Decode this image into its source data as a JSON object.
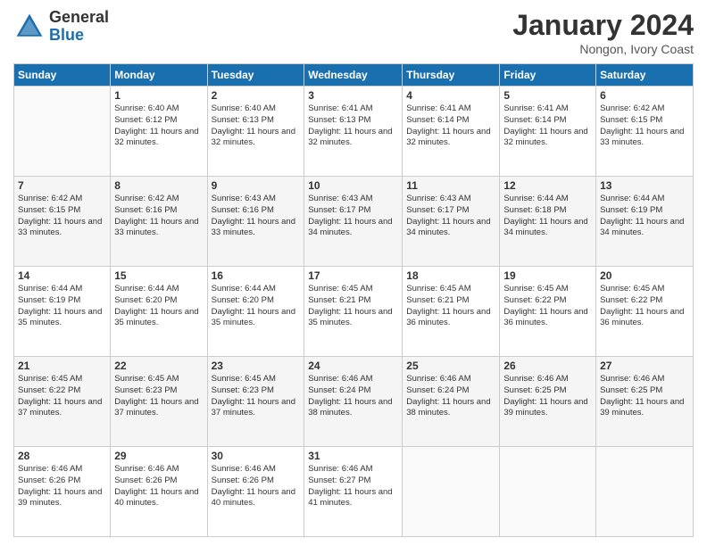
{
  "logo": {
    "general": "General",
    "blue": "Blue"
  },
  "title": "January 2024",
  "subtitle": "Nongon, Ivory Coast",
  "days_header": [
    "Sunday",
    "Monday",
    "Tuesday",
    "Wednesday",
    "Thursday",
    "Friday",
    "Saturday"
  ],
  "weeks": [
    [
      {
        "day": "",
        "empty": true
      },
      {
        "day": "1",
        "sunrise": "6:40 AM",
        "sunset": "6:12 PM",
        "daylight": "11 hours and 32 minutes."
      },
      {
        "day": "2",
        "sunrise": "6:40 AM",
        "sunset": "6:13 PM",
        "daylight": "11 hours and 32 minutes."
      },
      {
        "day": "3",
        "sunrise": "6:41 AM",
        "sunset": "6:13 PM",
        "daylight": "11 hours and 32 minutes."
      },
      {
        "day": "4",
        "sunrise": "6:41 AM",
        "sunset": "6:14 PM",
        "daylight": "11 hours and 32 minutes."
      },
      {
        "day": "5",
        "sunrise": "6:41 AM",
        "sunset": "6:14 PM",
        "daylight": "11 hours and 32 minutes."
      },
      {
        "day": "6",
        "sunrise": "6:42 AM",
        "sunset": "6:15 PM",
        "daylight": "11 hours and 33 minutes."
      }
    ],
    [
      {
        "day": "7",
        "sunrise": "6:42 AM",
        "sunset": "6:15 PM",
        "daylight": "11 hours and 33 minutes."
      },
      {
        "day": "8",
        "sunrise": "6:42 AM",
        "sunset": "6:16 PM",
        "daylight": "11 hours and 33 minutes."
      },
      {
        "day": "9",
        "sunrise": "6:43 AM",
        "sunset": "6:16 PM",
        "daylight": "11 hours and 33 minutes."
      },
      {
        "day": "10",
        "sunrise": "6:43 AM",
        "sunset": "6:17 PM",
        "daylight": "11 hours and 34 minutes."
      },
      {
        "day": "11",
        "sunrise": "6:43 AM",
        "sunset": "6:17 PM",
        "daylight": "11 hours and 34 minutes."
      },
      {
        "day": "12",
        "sunrise": "6:44 AM",
        "sunset": "6:18 PM",
        "daylight": "11 hours and 34 minutes."
      },
      {
        "day": "13",
        "sunrise": "6:44 AM",
        "sunset": "6:19 PM",
        "daylight": "11 hours and 34 minutes."
      }
    ],
    [
      {
        "day": "14",
        "sunrise": "6:44 AM",
        "sunset": "6:19 PM",
        "daylight": "11 hours and 35 minutes."
      },
      {
        "day": "15",
        "sunrise": "6:44 AM",
        "sunset": "6:20 PM",
        "daylight": "11 hours and 35 minutes."
      },
      {
        "day": "16",
        "sunrise": "6:44 AM",
        "sunset": "6:20 PM",
        "daylight": "11 hours and 35 minutes."
      },
      {
        "day": "17",
        "sunrise": "6:45 AM",
        "sunset": "6:21 PM",
        "daylight": "11 hours and 35 minutes."
      },
      {
        "day": "18",
        "sunrise": "6:45 AM",
        "sunset": "6:21 PM",
        "daylight": "11 hours and 36 minutes."
      },
      {
        "day": "19",
        "sunrise": "6:45 AM",
        "sunset": "6:22 PM",
        "daylight": "11 hours and 36 minutes."
      },
      {
        "day": "20",
        "sunrise": "6:45 AM",
        "sunset": "6:22 PM",
        "daylight": "11 hours and 36 minutes."
      }
    ],
    [
      {
        "day": "21",
        "sunrise": "6:45 AM",
        "sunset": "6:22 PM",
        "daylight": "11 hours and 37 minutes."
      },
      {
        "day": "22",
        "sunrise": "6:45 AM",
        "sunset": "6:23 PM",
        "daylight": "11 hours and 37 minutes."
      },
      {
        "day": "23",
        "sunrise": "6:45 AM",
        "sunset": "6:23 PM",
        "daylight": "11 hours and 37 minutes."
      },
      {
        "day": "24",
        "sunrise": "6:46 AM",
        "sunset": "6:24 PM",
        "daylight": "11 hours and 38 minutes."
      },
      {
        "day": "25",
        "sunrise": "6:46 AM",
        "sunset": "6:24 PM",
        "daylight": "11 hours and 38 minutes."
      },
      {
        "day": "26",
        "sunrise": "6:46 AM",
        "sunset": "6:25 PM",
        "daylight": "11 hours and 39 minutes."
      },
      {
        "day": "27",
        "sunrise": "6:46 AM",
        "sunset": "6:25 PM",
        "daylight": "11 hours and 39 minutes."
      }
    ],
    [
      {
        "day": "28",
        "sunrise": "6:46 AM",
        "sunset": "6:26 PM",
        "daylight": "11 hours and 39 minutes."
      },
      {
        "day": "29",
        "sunrise": "6:46 AM",
        "sunset": "6:26 PM",
        "daylight": "11 hours and 40 minutes."
      },
      {
        "day": "30",
        "sunrise": "6:46 AM",
        "sunset": "6:26 PM",
        "daylight": "11 hours and 40 minutes."
      },
      {
        "day": "31",
        "sunrise": "6:46 AM",
        "sunset": "6:27 PM",
        "daylight": "11 hours and 41 minutes."
      },
      {
        "day": "",
        "empty": true
      },
      {
        "day": "",
        "empty": true
      },
      {
        "day": "",
        "empty": true
      }
    ]
  ]
}
